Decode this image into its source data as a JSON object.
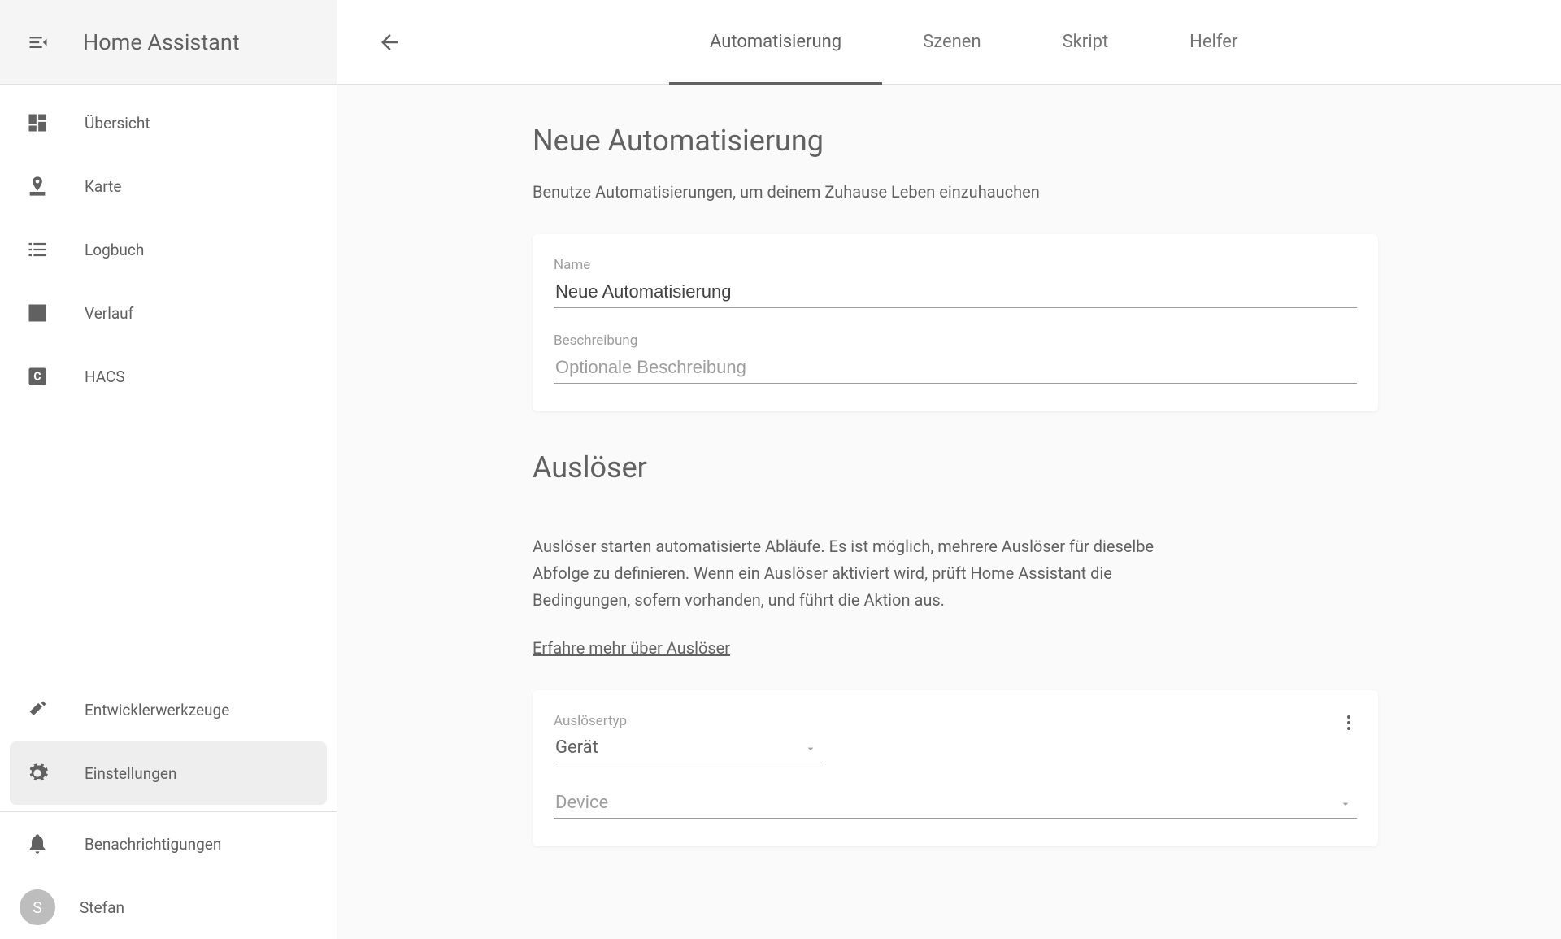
{
  "app": {
    "title": "Home Assistant"
  },
  "sidebar": {
    "items": [
      {
        "label": "Übersicht"
      },
      {
        "label": "Karte"
      },
      {
        "label": "Logbuch"
      },
      {
        "label": "Verlauf"
      },
      {
        "label": "HACS"
      }
    ],
    "devtools": {
      "label": "Entwicklerwerkzeuge"
    },
    "settings": {
      "label": "Einstellungen"
    },
    "notifications": {
      "label": "Benachrichtigungen"
    },
    "user": {
      "name": "Stefan",
      "initial": "S"
    }
  },
  "tabs": [
    {
      "label": "Automatisierung"
    },
    {
      "label": "Szenen"
    },
    {
      "label": "Skript"
    },
    {
      "label": "Helfer"
    }
  ],
  "page": {
    "title": "Neue Automatisierung",
    "subtitle": "Benutze Automatisierungen, um deinem Zuhause Leben einzuhauchen",
    "name_label": "Name",
    "name_value": "Neue Automatisierung",
    "desc_label": "Beschreibung",
    "desc_placeholder": "Optionale Beschreibung"
  },
  "trigger": {
    "title": "Auslöser",
    "desc": "Auslöser starten automatisierte Abläufe. Es ist möglich, mehrere Auslöser für dieselbe Abfolge zu definieren. Wenn ein Auslöser aktiviert wird, prüft Home Assistant die Bedingungen, sofern vorhanden, und führt die Aktion aus.",
    "learn_more": "Erfahre mehr über Auslöser",
    "type_label": "Auslösertyp",
    "type_value": "Gerät",
    "device_placeholder": "Device"
  }
}
